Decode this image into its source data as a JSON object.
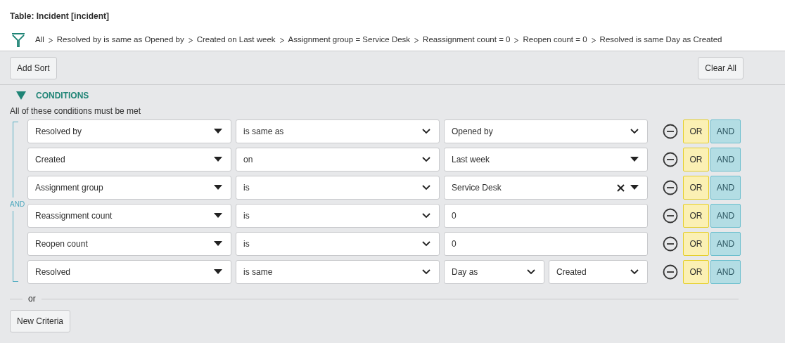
{
  "table_title": "Table: Incident [incident]",
  "breadcrumbs": [
    "All",
    "Resolved by is same as Opened by",
    "Created on Last week",
    "Assignment group = Service Desk",
    "Reassignment count = 0",
    "Reopen count = 0",
    "Resolved is same Day as Created"
  ],
  "toolbar": {
    "add_sort": "Add Sort",
    "clear_all": "Clear All"
  },
  "conditions": {
    "heading": "CONDITIONS",
    "expanded": true,
    "note": "All of these conditions must be met",
    "group_label": "AND",
    "rows": [
      {
        "field": "Resolved by",
        "operator": "is same as",
        "kind": "select",
        "values": [
          "Opened by"
        ],
        "or": "OR",
        "and": "AND"
      },
      {
        "field": "Created",
        "operator": "on",
        "kind": "choice",
        "values": [
          "Last week"
        ],
        "or": "OR",
        "and": "AND"
      },
      {
        "field": "Assignment group",
        "operator": "is",
        "kind": "reference",
        "values": [
          "Service Desk"
        ],
        "or": "OR",
        "and": "AND"
      },
      {
        "field": "Reassignment count",
        "operator": "is",
        "kind": "text",
        "values": [
          "0"
        ],
        "or": "OR",
        "and": "AND"
      },
      {
        "field": "Reopen count",
        "operator": "is",
        "kind": "text",
        "values": [
          "0"
        ],
        "or": "OR",
        "and": "AND"
      },
      {
        "field": "Resolved",
        "operator": "is same",
        "kind": "pair",
        "values": [
          "Day as",
          "Created"
        ],
        "or": "OR",
        "and": "AND"
      }
    ]
  },
  "or_separator": "or",
  "new_criteria": "New Criteria"
}
